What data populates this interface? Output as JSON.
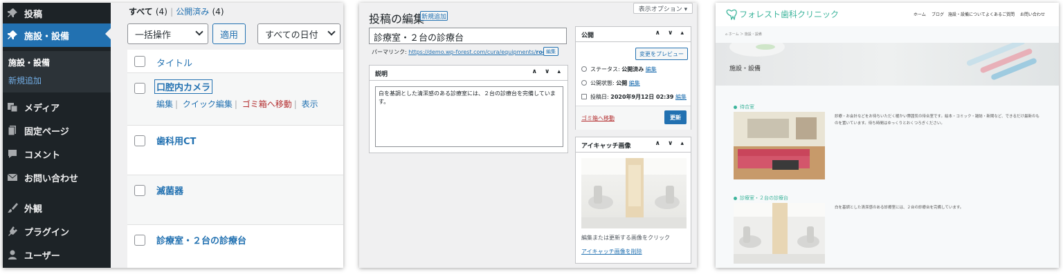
{
  "panel1": {
    "menu": [
      {
        "label": "投稿",
        "icon": "pin-icon"
      },
      {
        "label": "施設・設備",
        "icon": "pin-icon"
      },
      {
        "label": "メディア",
        "icon": "media-icon"
      },
      {
        "label": "固定ページ",
        "icon": "page-icon"
      },
      {
        "label": "コメント",
        "icon": "comment-icon"
      },
      {
        "label": "お問い合わせ",
        "icon": "mail-icon"
      },
      {
        "label": "外観",
        "icon": "brush-icon"
      },
      {
        "label": "プラグイン",
        "icon": "plugin-icon"
      },
      {
        "label": "ユーザー",
        "icon": "user-icon"
      }
    ],
    "submenu": {
      "current": "施設・設備",
      "add_new": "新規追加"
    },
    "filters": {
      "all": "すべて",
      "all_count": "(4)",
      "sep": "|",
      "published": "公開済み",
      "published_count": "(4)"
    },
    "bulk_action": "一括操作",
    "apply": "適用",
    "date_filter": "すべての日付",
    "column_title": "タイトル",
    "rows": [
      {
        "title": "口腔内カメラ"
      },
      {
        "title": "歯科用CT"
      },
      {
        "title": "滅菌器"
      },
      {
        "title": "診療室・２台の診療台"
      }
    ],
    "row_actions": {
      "edit": "編集",
      "quick_edit": "クイック編集",
      "trash": "ゴミ箱へ移動",
      "view": "表示"
    }
  },
  "panel2": {
    "screen_options": "表示オプション ▾",
    "heading": "投稿の編集",
    "add_new": "新規追加",
    "post_title": "診療室・２台の診療台",
    "permalink_label": "パーマリンク:",
    "permalink_url_prefix": "https://demo.wp-forest.com/cura/equipments/",
    "permalink_url_slug": "room",
    "permalink_url_suffix": "/",
    "permalink_edit": "編集",
    "desc_box_title": "説明",
    "desc_text": "白を基調とした清潔感のある診療室には、２台の診療台を完備しています。",
    "publish_box_title": "公開",
    "preview": "変更をプレビュー",
    "status_label": "ステータス:",
    "status_value": "公開済み",
    "visibility_label": "公開状態:",
    "visibility_value": "公開",
    "date_label": "投稿日:",
    "date_value": "2020年9月12日 02:39",
    "edit": "編集",
    "trash": "ゴミ箱へ移動",
    "update": "更新",
    "featured_box_title": "アイキャッチ画像",
    "featured_hint": "編集または更新する画像をクリック",
    "featured_remove": "アイキャッチ画像を削除",
    "box_controls": "∧ ∨ ▴"
  },
  "panel3": {
    "site_name": "フォレスト歯科クリニック",
    "nav": [
      "ホーム",
      "ブログ",
      "施設・設備について",
      "よくあるご質問",
      "お問い合わせ"
    ],
    "breadcrumb": "⌂ ホーム ＞ 施設・設備",
    "hero_title": "施設・設備",
    "sections": [
      {
        "title": "待合室",
        "text": "診療・お会計などをお待ちいただく暖かい雰囲気の待合室です。絵本・コミック・雑誌・新聞など、できるだけ最新のものを置いています。待ち時間はゆっくりとおくつろぎください。"
      },
      {
        "title": "診療室・２台の診療台",
        "text": "白を基調とした清潔感のある診療室には、２台の診療台を完備しています。"
      }
    ],
    "brand_color": "#3cb49b"
  }
}
